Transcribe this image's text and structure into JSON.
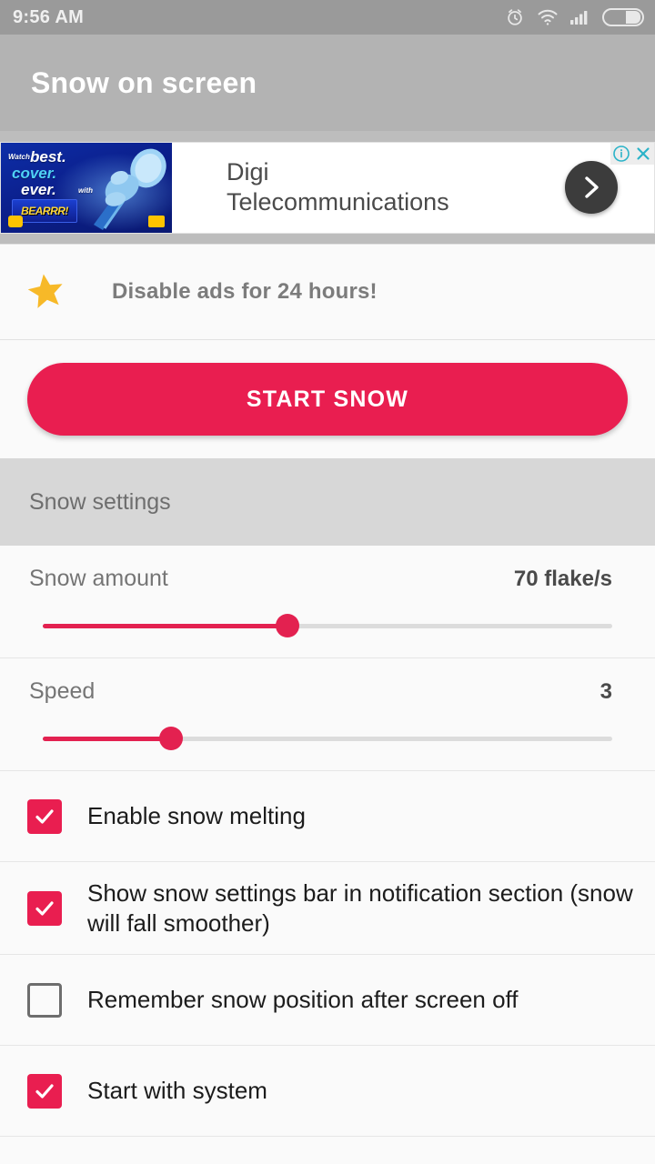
{
  "status_bar": {
    "time": "9:56 AM",
    "icons": [
      "alarm-icon",
      "wifi-icon",
      "signal-icon",
      "battery-icon"
    ]
  },
  "action_bar": {
    "title": "Snow on screen"
  },
  "ad": {
    "headline_line1": "Digi",
    "headline_line2": "Telecommunications",
    "creative": {
      "watch": "Watch",
      "best": "best.",
      "cover": "cover.",
      "ever": "ever.",
      "with": "with",
      "badge": "BEARRR!"
    },
    "arrow_icon": "chevron-right-icon",
    "info_icon": "ad-info-icon",
    "close_icon": "ad-close-icon",
    "info_glyph": "i",
    "close_glyph": "✕"
  },
  "promo": {
    "icon": "star-icon",
    "label": "Disable ads for 24 hours!"
  },
  "main_action": {
    "start_label": "START SNOW"
  },
  "settings_section": {
    "header": "Snow settings"
  },
  "sliders": [
    {
      "name": "snow-amount",
      "label": "Snow amount",
      "value_text": "70 flake/s",
      "percent": 43
    },
    {
      "name": "speed",
      "label": "Speed",
      "value_text": "3",
      "percent": 22.5
    }
  ],
  "checkboxes": [
    {
      "name": "enable-snow-melting",
      "label": "Enable snow melting",
      "checked": true
    },
    {
      "name": "show-settings-bar",
      "label": "Show snow settings bar in notification section (snow will fall smoother)",
      "checked": true
    },
    {
      "name": "remember-snow-position",
      "label": "Remember snow position after screen off",
      "checked": false
    },
    {
      "name": "start-with-system",
      "label": "Start with system",
      "checked": true
    }
  ],
  "colors": {
    "accent": "#e91e50",
    "slider_accent": "#e32150",
    "star": "#f7b928",
    "status_bar_bg": "#9a9a9a",
    "action_bar_bg": "#b3b3b3",
    "section_header_bg": "#d7d7d7",
    "page_bg": "#fafafa",
    "ad_control": "#2ab3c8"
  }
}
